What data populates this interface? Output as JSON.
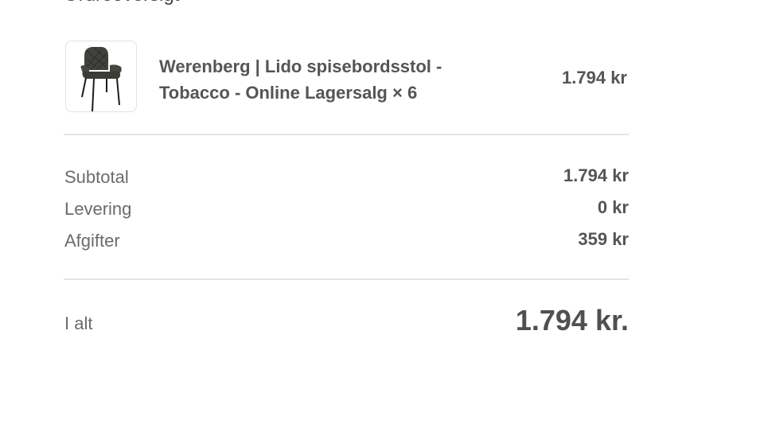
{
  "header": {
    "title": "Ordreoversigt"
  },
  "product": {
    "image_icon": "chair-thumbnail",
    "name": "Werenberg | Lido spisebordsstol - Tobacco - Online Lagersalg × 6",
    "price": "1.794 kr"
  },
  "summary": {
    "subtotal_label": "Subtotal",
    "subtotal_value": "1.794 kr",
    "shipping_label": "Levering",
    "shipping_value": "0 kr",
    "taxes_label": "Afgifter",
    "taxes_value": "359 kr"
  },
  "total": {
    "label": "I alt",
    "value": "1.794 kr."
  },
  "colors": {
    "text": "#555555",
    "muted": "#6b6b6b",
    "divider": "#e4e4e4",
    "thumb_border": "#e2e2e2"
  }
}
